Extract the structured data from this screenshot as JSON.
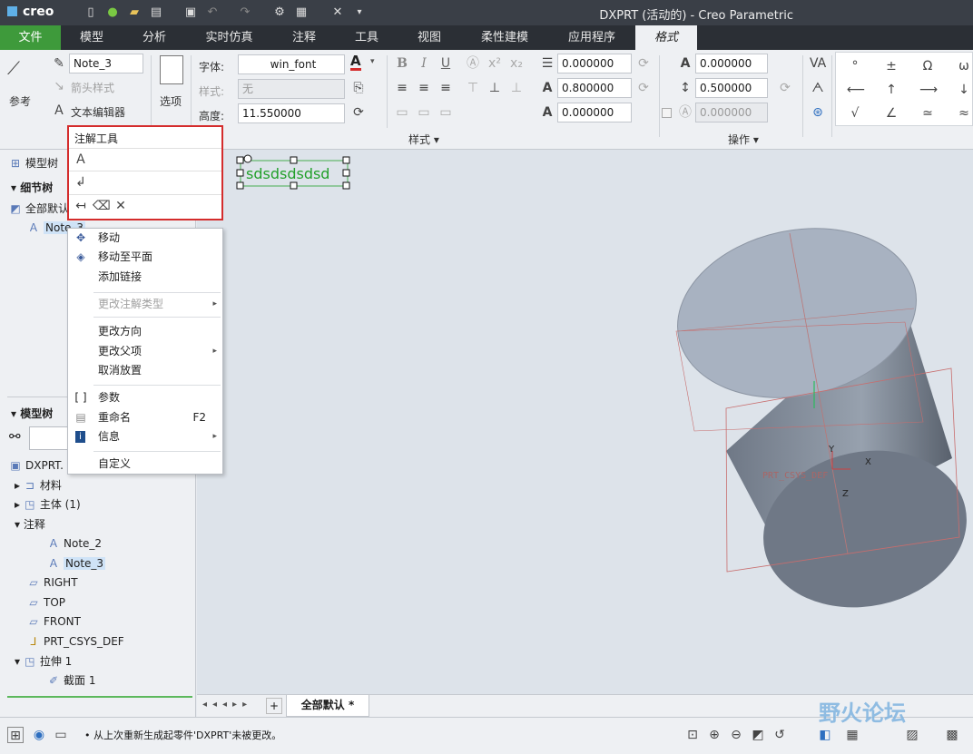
{
  "app": {
    "logo": "creo",
    "window_title": "DXPRT (活动的) - Creo Parametric"
  },
  "tabs": [
    "文件",
    "模型",
    "分析",
    "实时仿真",
    "注释",
    "工具",
    "视图",
    "柔性建模",
    "应用程序",
    "格式"
  ],
  "ribbon": {
    "reference_label": "参考",
    "note_name": "Note_3",
    "arrow_style_label": "箭头样式",
    "text_editor_label": "文本编辑器",
    "options_label": "选项",
    "font_label": "字体:",
    "font_value": "win_font",
    "style_label": "样式:",
    "style_value": "无",
    "height_label": "高度:",
    "height_value": "11.550000",
    "num1": "0.000000",
    "num2": "0.800000",
    "num3": "0.000000",
    "num4": "0.000000",
    "num5": "0.500000",
    "num6": "0.000000",
    "group_style": "样式",
    "group_operation": "操作",
    "bold": "B",
    "italic": "I",
    "underline": "U"
  },
  "sidebar": {
    "model_tree_tab": "模型树",
    "detail_tree": "细节树",
    "all_default": "全部默认",
    "note_item": "Note_3",
    "model_tree_header": "模型树",
    "root": "DXPRT.",
    "items": [
      "材料",
      "主体 (1)",
      "注释",
      "Note_2",
      "Note_3",
      "RIGHT",
      "TOP",
      "FRONT",
      "PRT_CSYS_DEF",
      "拉伸 1",
      "截面 1"
    ]
  },
  "mini_toolbar": {
    "title": "注解工具"
  },
  "context_menu": {
    "items": [
      "移动",
      "移动至平面",
      "添加链接",
      "更改注解类型",
      "更改方向",
      "更改父项",
      "取消放置",
      "参数",
      "重命名",
      "信息",
      "自定义"
    ],
    "rename_shortcut": "F2"
  },
  "canvas": {
    "note_text": "sdsdsdsdsd",
    "csys_label": "PRT_CSYS_DEF",
    "axis_x": "X",
    "axis_y": "Y",
    "axis_z": "Z",
    "watermark": "野火论坛"
  },
  "canvas_tab": "全部默认 *",
  "status": {
    "message": "从上次重新生成起零件'DXPRT'未被更改。"
  },
  "colors": {
    "file_tab": "#3e9a3b",
    "selection": "#22a02a",
    "highlight_border": "#d42c2c",
    "cylinder": "#8e98a7"
  }
}
